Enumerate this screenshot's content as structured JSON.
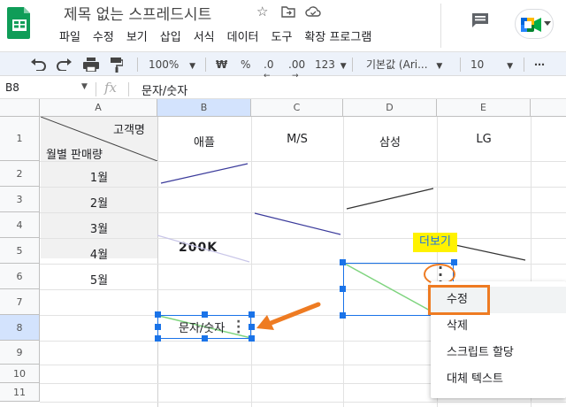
{
  "app": {
    "doc_title": "제목 없는 스프레드시트",
    "menu": [
      "파일",
      "수정",
      "보기",
      "삽입",
      "서식",
      "데이터",
      "도구",
      "확장 프로그램"
    ]
  },
  "toolbar": {
    "zoom": "100%",
    "currency": "₩",
    "percent": "%",
    "decimal_decrease": ".0",
    "decimal_increase": ".00",
    "number_format": "123",
    "font": "기본값 (Ari...",
    "font_size": "10",
    "more": "⋯"
  },
  "formula_bar": {
    "cell_ref": "B8",
    "fx": "fx",
    "content": "문자/숫자"
  },
  "grid": {
    "columns": [
      "A",
      "B",
      "C",
      "D",
      "E"
    ],
    "rows": [
      "1",
      "2",
      "3",
      "4",
      "5",
      "6",
      "7",
      "8",
      "9",
      "10",
      "11"
    ],
    "header_top_label": "고객명",
    "header_bottom_label": "월별 판매량",
    "brands": [
      "애플",
      "M/S",
      "삼성",
      "LG"
    ],
    "months": [
      "1월",
      "2월",
      "3월",
      "4월",
      "5월"
    ],
    "b5_label": "200K"
  },
  "drawing": {
    "selected_text": "문자/숫자",
    "more_tooltip": "더보기"
  },
  "context_menu": {
    "items": [
      "수정",
      "삭제",
      "스크립트 할당",
      "대체 텍스트"
    ]
  },
  "colors": {
    "selection_blue": "#1a73e8",
    "annotation_orange": "#ee7b22",
    "tooltip_yellow": "#fff200",
    "line_green": "#7ed47e",
    "line_navy": "#3b3b9b"
  }
}
